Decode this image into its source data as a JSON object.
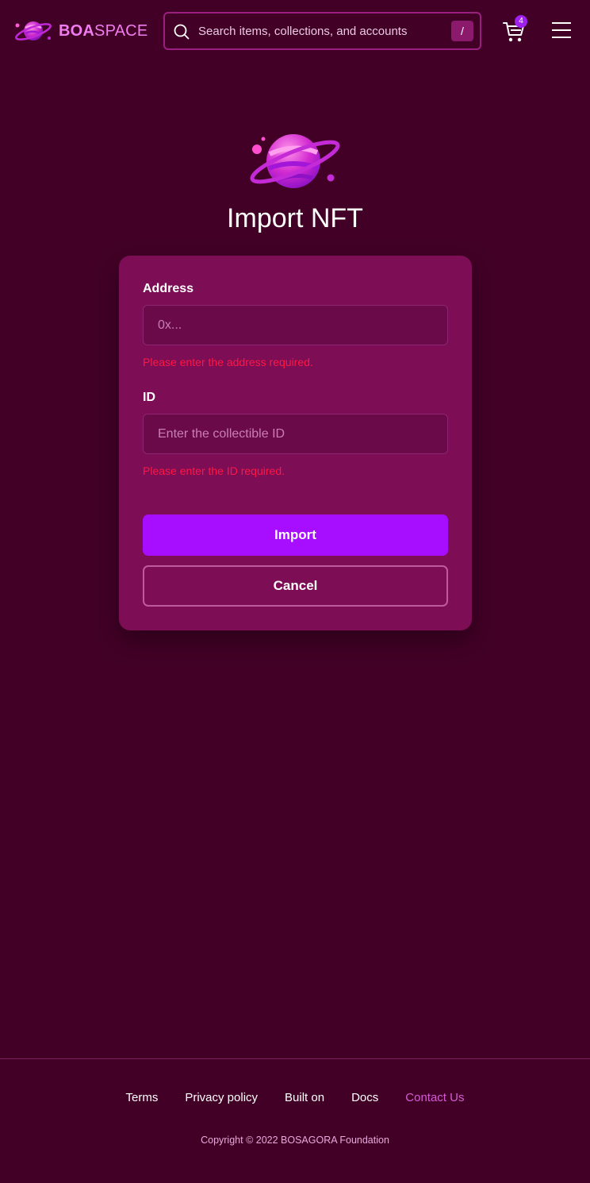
{
  "header": {
    "logo": {
      "bold": "BOA",
      "light": "SPACE"
    },
    "search": {
      "placeholder": "Search items, collections, and accounts",
      "shortcut": "/"
    },
    "cart": {
      "count": "4"
    },
    "menu_icon": "hamburger-icon"
  },
  "main": {
    "title": "Import NFT",
    "form": {
      "address": {
        "label": "Address",
        "placeholder": "0x...",
        "error": "Please enter the address required."
      },
      "id": {
        "label": "ID",
        "placeholder": "Enter the collectible ID",
        "error": "Please enter the ID required."
      },
      "import_label": "Import",
      "cancel_label": "Cancel"
    }
  },
  "footer": {
    "links": [
      {
        "label": "Terms"
      },
      {
        "label": "Privacy policy"
      },
      {
        "label": "Built on"
      },
      {
        "label": "Docs"
      },
      {
        "label": "Contact Us"
      }
    ],
    "copyright": "Copyright © 2022 BOSAGORA Foundation"
  },
  "colors": {
    "background": "#420026",
    "card": "#7d0d55",
    "accent": "#a70dff",
    "error": "#ff1744",
    "link_accent": "#d65bd6"
  }
}
